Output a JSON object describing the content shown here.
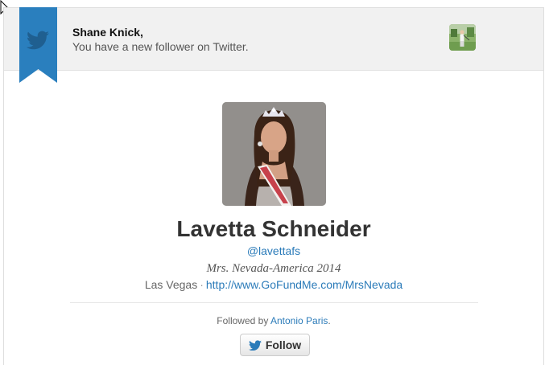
{
  "header": {
    "recipient_name": "Shane Knick,",
    "message": "You have a new follower on Twitter."
  },
  "profile": {
    "display_name": "Lavetta Schneider",
    "handle": "@lavettafs",
    "bio": "Mrs. Nevada-America 2014",
    "location": "Las Vegas",
    "separator": "·",
    "website": "http://www.GoFundMe.com/MrsNevada"
  },
  "social": {
    "followed_by_prefix": "Followed by",
    "followed_by_name": "Antonio Paris",
    "followed_by_suffix": "."
  },
  "actions": {
    "follow_label": "Follow"
  },
  "icons": {
    "ribbon": "twitter-bird-icon",
    "button": "twitter-bird-icon",
    "cursor": "mouse-pointer-icon"
  },
  "colors": {
    "twitter_blue": "#2b7bb9",
    "ribbon_blue": "#2a7fbe"
  }
}
